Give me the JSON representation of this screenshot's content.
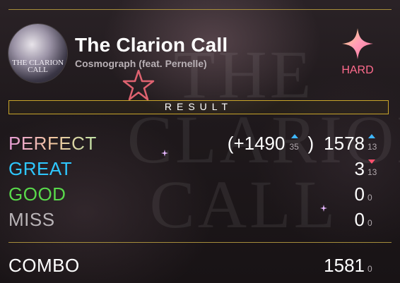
{
  "song": {
    "title": "The Clarion Call",
    "artist": "Cosmograph (feat. Pernelle)",
    "jacket_text": "THE CLARION CALL",
    "background_text": "THE CLARION CALL"
  },
  "difficulty": {
    "label": "HARD",
    "color": "#ff6b8d",
    "icon": "four-point-star-icon"
  },
  "result": {
    "header": "RESULT"
  },
  "judgements": {
    "perfect": {
      "label": "PERFECT",
      "early_value": "(+1490",
      "early_delta": "35",
      "early_close": ")",
      "value": "1578",
      "delta": "13",
      "delta_dir": "up"
    },
    "great": {
      "label": "GREAT",
      "value": "3",
      "delta": "13",
      "delta_dir": "down"
    },
    "good": {
      "label": "GOOD",
      "value": "0",
      "delta": "0"
    },
    "miss": {
      "label": "MISS",
      "value": "0",
      "delta": "0"
    }
  },
  "combo": {
    "label": "COMBO",
    "value": "1581",
    "delta": "0"
  },
  "colors": {
    "accent_gold": "#c9a52a",
    "great": "#2ec7ff",
    "good": "#59d94b",
    "miss": "#b9b4b7",
    "up_arrow": "#3fb7ff",
    "down_arrow": "#ff4f6c"
  }
}
